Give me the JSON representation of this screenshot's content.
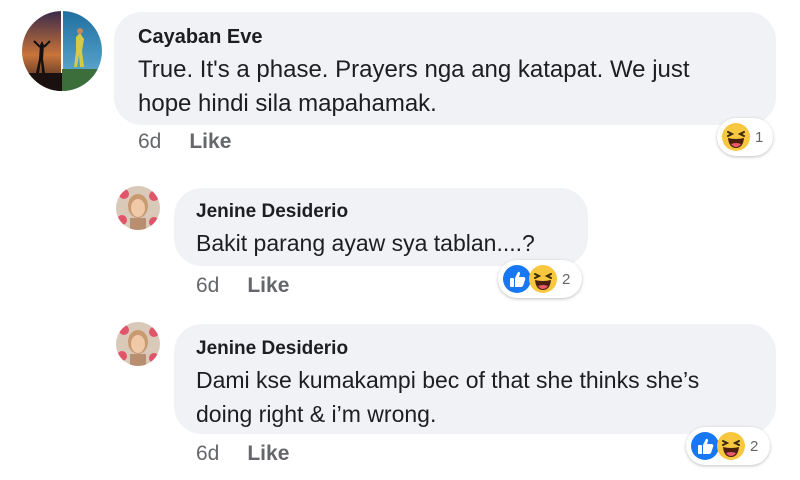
{
  "comments": [
    {
      "author": "Cayaban Eve",
      "text": "True. It's a phase. Prayers nga ang katapat. We just\nhope hindi sila mapahamak.",
      "time": "6d",
      "like_label": "Like",
      "reactions": [
        "haha"
      ],
      "reaction_count": "1"
    },
    {
      "author": "Jenine Desiderio",
      "text": "Bakit parang ayaw sya tablan....?",
      "time": "6d",
      "like_label": "Like",
      "reactions": [
        "like",
        "haha"
      ],
      "reaction_count": "2"
    },
    {
      "author": "Jenine Desiderio",
      "text": "Dami kse kumakampi bec of that she thinks she’s\ndoing right & i’m wrong.",
      "time": "6d",
      "like_label": "Like",
      "reactions": [
        "like",
        "haha"
      ],
      "reaction_count": "2"
    }
  ],
  "colors": {
    "bubble": "#f0f2f5",
    "like_blue": "#1877f2",
    "haha_yellow": "#f7c740",
    "meta_gray": "#65676b"
  }
}
